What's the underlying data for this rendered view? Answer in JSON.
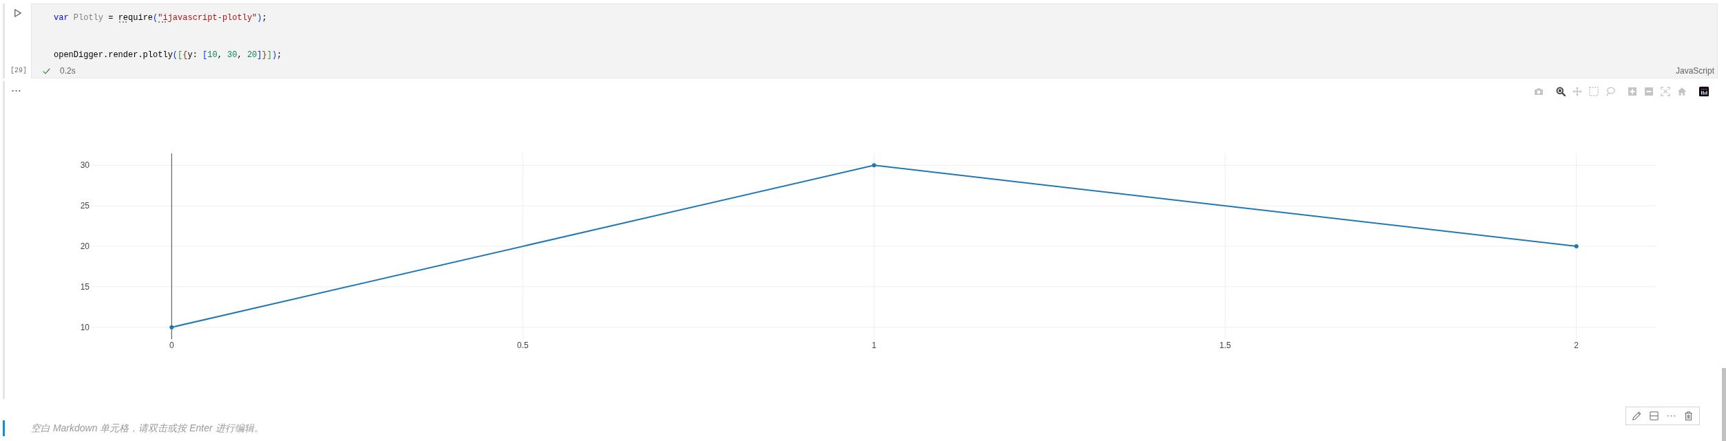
{
  "cells": [
    {
      "kind": "code",
      "focused": false,
      "code_lines": [
        [
          {
            "text": "var",
            "kind": "keyword",
            "hint": false
          },
          {
            "text": " Plotly",
            "kind": "unused",
            "hint": false
          },
          {
            "text": " = ",
            "kind": "plain",
            "hint": false
          },
          {
            "text": "require",
            "kind": "plain",
            "hint": true
          },
          {
            "text": "(",
            "kind": "bracket1",
            "hint": false
          },
          {
            "text": "\"ijavascript-plotly\"",
            "kind": "string",
            "hint": true
          },
          {
            "text": ")",
            "kind": "bracket1",
            "hint": false
          },
          {
            "text": ";",
            "kind": "plain",
            "hint": false
          }
        ],
        [
          {
            "text": "openDigger.render.plotly",
            "kind": "plain",
            "hint": false
          },
          {
            "text": "(",
            "kind": "bracket1",
            "hint": false
          },
          {
            "text": "[",
            "kind": "bracket2",
            "hint": false
          },
          {
            "text": "{",
            "kind": "bracket3",
            "hint": false
          },
          {
            "text": "y: ",
            "kind": "plain",
            "hint": false
          },
          {
            "text": "[",
            "kind": "bracket1",
            "hint": false
          },
          {
            "text": "10",
            "kind": "number",
            "hint": false
          },
          {
            "text": ", ",
            "kind": "plain",
            "hint": false
          },
          {
            "text": "30",
            "kind": "number",
            "hint": false
          },
          {
            "text": ", ",
            "kind": "plain",
            "hint": false
          },
          {
            "text": "20",
            "kind": "number",
            "hint": false
          },
          {
            "text": "]",
            "kind": "bracket1",
            "hint": false
          },
          {
            "text": "}",
            "kind": "bracket3",
            "hint": false
          },
          {
            "text": "]",
            "kind": "bracket2",
            "hint": false
          },
          {
            "text": ")",
            "kind": "bracket1",
            "hint": false
          },
          {
            "text": ";",
            "kind": "plain",
            "hint": false
          }
        ]
      ],
      "execution_count": "[29]",
      "succeeded": true,
      "duration": "0.2s",
      "language": "JavaScript",
      "output": {
        "modebar": [
          [
            {
              "kind": "camera",
              "selected": false
            }
          ],
          [
            {
              "kind": "zoom",
              "selected": true
            },
            {
              "kind": "pan",
              "selected": false
            },
            {
              "kind": "select",
              "selected": false
            },
            {
              "kind": "lasso",
              "selected": false
            }
          ],
          [
            {
              "kind": "zoomin",
              "selected": false
            },
            {
              "kind": "zoomout",
              "selected": false
            },
            {
              "kind": "autoscale",
              "selected": false
            },
            {
              "kind": "reset",
              "selected": false
            }
          ]
        ],
        "chart_data": {
          "type": "line",
          "x": [
            0,
            1,
            2
          ],
          "series": [
            {
              "color": "#1f77b4",
              "marker": true,
              "values": [
                10,
                30,
                20
              ]
            }
          ],
          "xlim": [
            -0.114,
            2.114
          ],
          "ylim": [
            8.53,
            31.47
          ],
          "xticks": [
            0,
            0.5,
            1,
            1.5,
            2
          ],
          "yticks": [
            10,
            15,
            20,
            25,
            30
          ],
          "grid": true
        }
      }
    },
    {
      "kind": "markdown",
      "focused": true,
      "hint": "空白 Markdown 单元格，请双击或按 Enter 进行编辑。"
    }
  ]
}
